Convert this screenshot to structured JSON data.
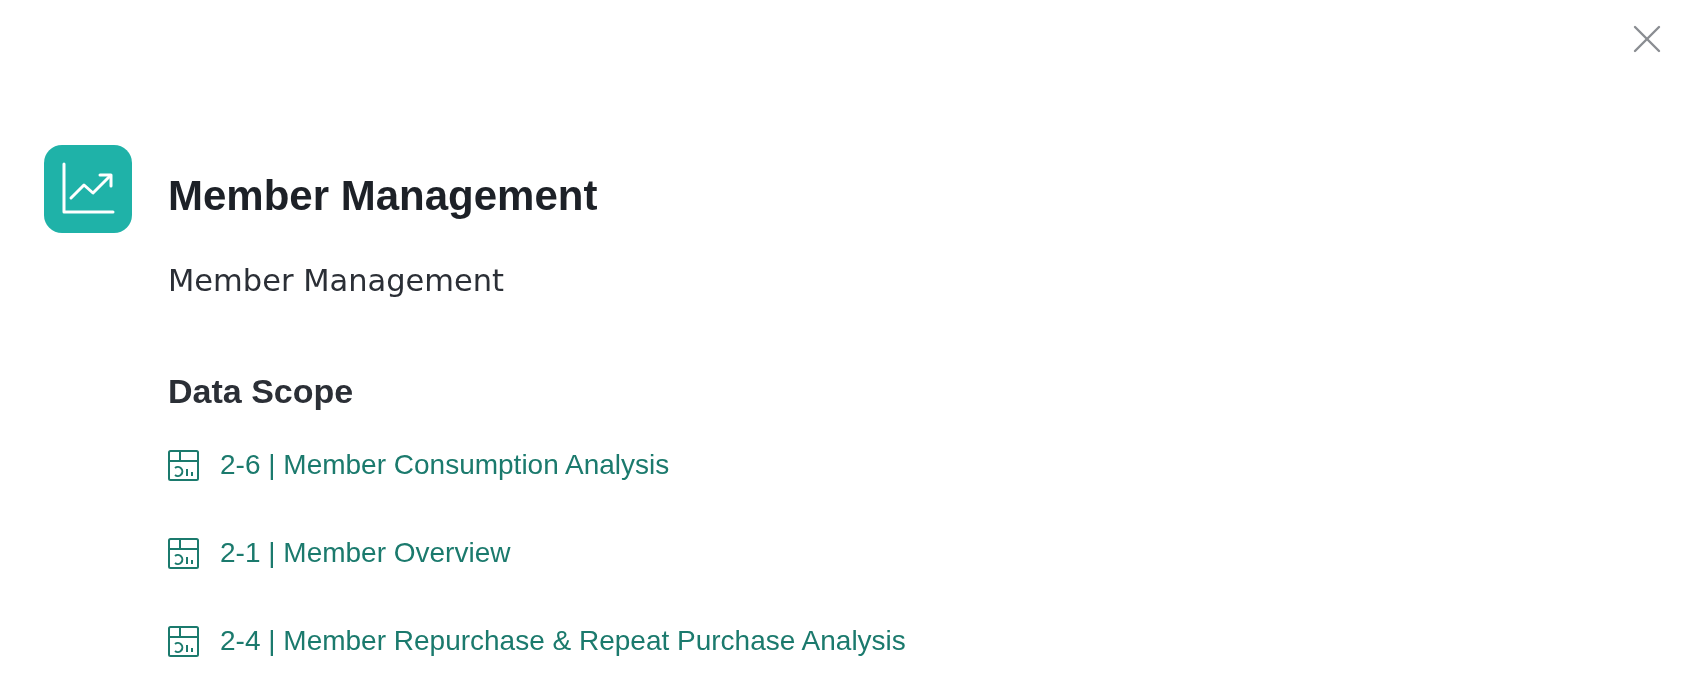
{
  "header": {
    "title": "Member Management",
    "subtitle": "Member Management"
  },
  "data_scope": {
    "heading": "Data Scope",
    "items": [
      {
        "label": "2-6 | Member Consumption Analysis"
      },
      {
        "label": "2-1 | Member Overview"
      },
      {
        "label": "2-4 | Member Repurchase & Repeat Purchase Analysis"
      }
    ]
  }
}
